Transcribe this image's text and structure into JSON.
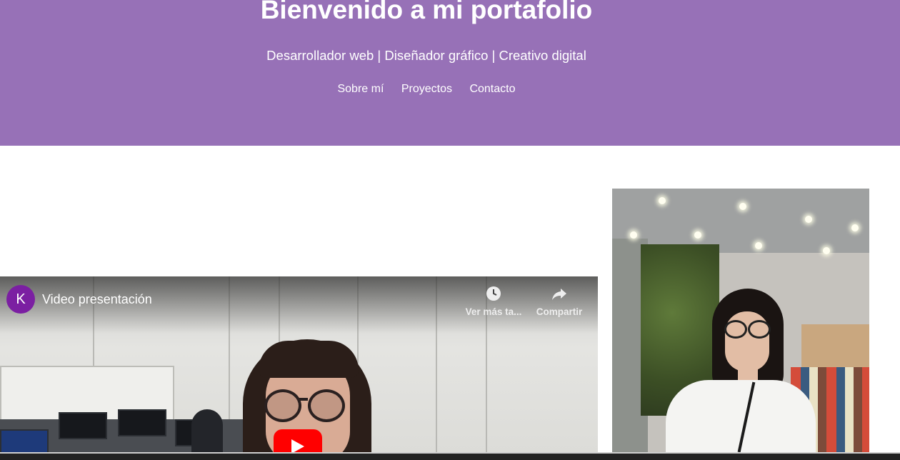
{
  "header": {
    "title": "Bienvenido a mi portafolio",
    "subtitle": "Desarrollador web | Diseñador gráfico | Creativo digital",
    "nav": [
      {
        "label": "Sobre mí"
      },
      {
        "label": "Proyectos"
      },
      {
        "label": "Contacto"
      }
    ],
    "background_color": "#9771b7"
  },
  "video": {
    "channel_initial": "K",
    "channel_color": "#7b1fa2",
    "title": "Video presentación",
    "watch_later_label": "Ver más ta...",
    "share_label": "Compartir",
    "icons": [
      "clock-icon",
      "share-arrow-icon",
      "play-icon"
    ]
  },
  "profile_photo": {
    "description_icon": "profile-photo"
  }
}
